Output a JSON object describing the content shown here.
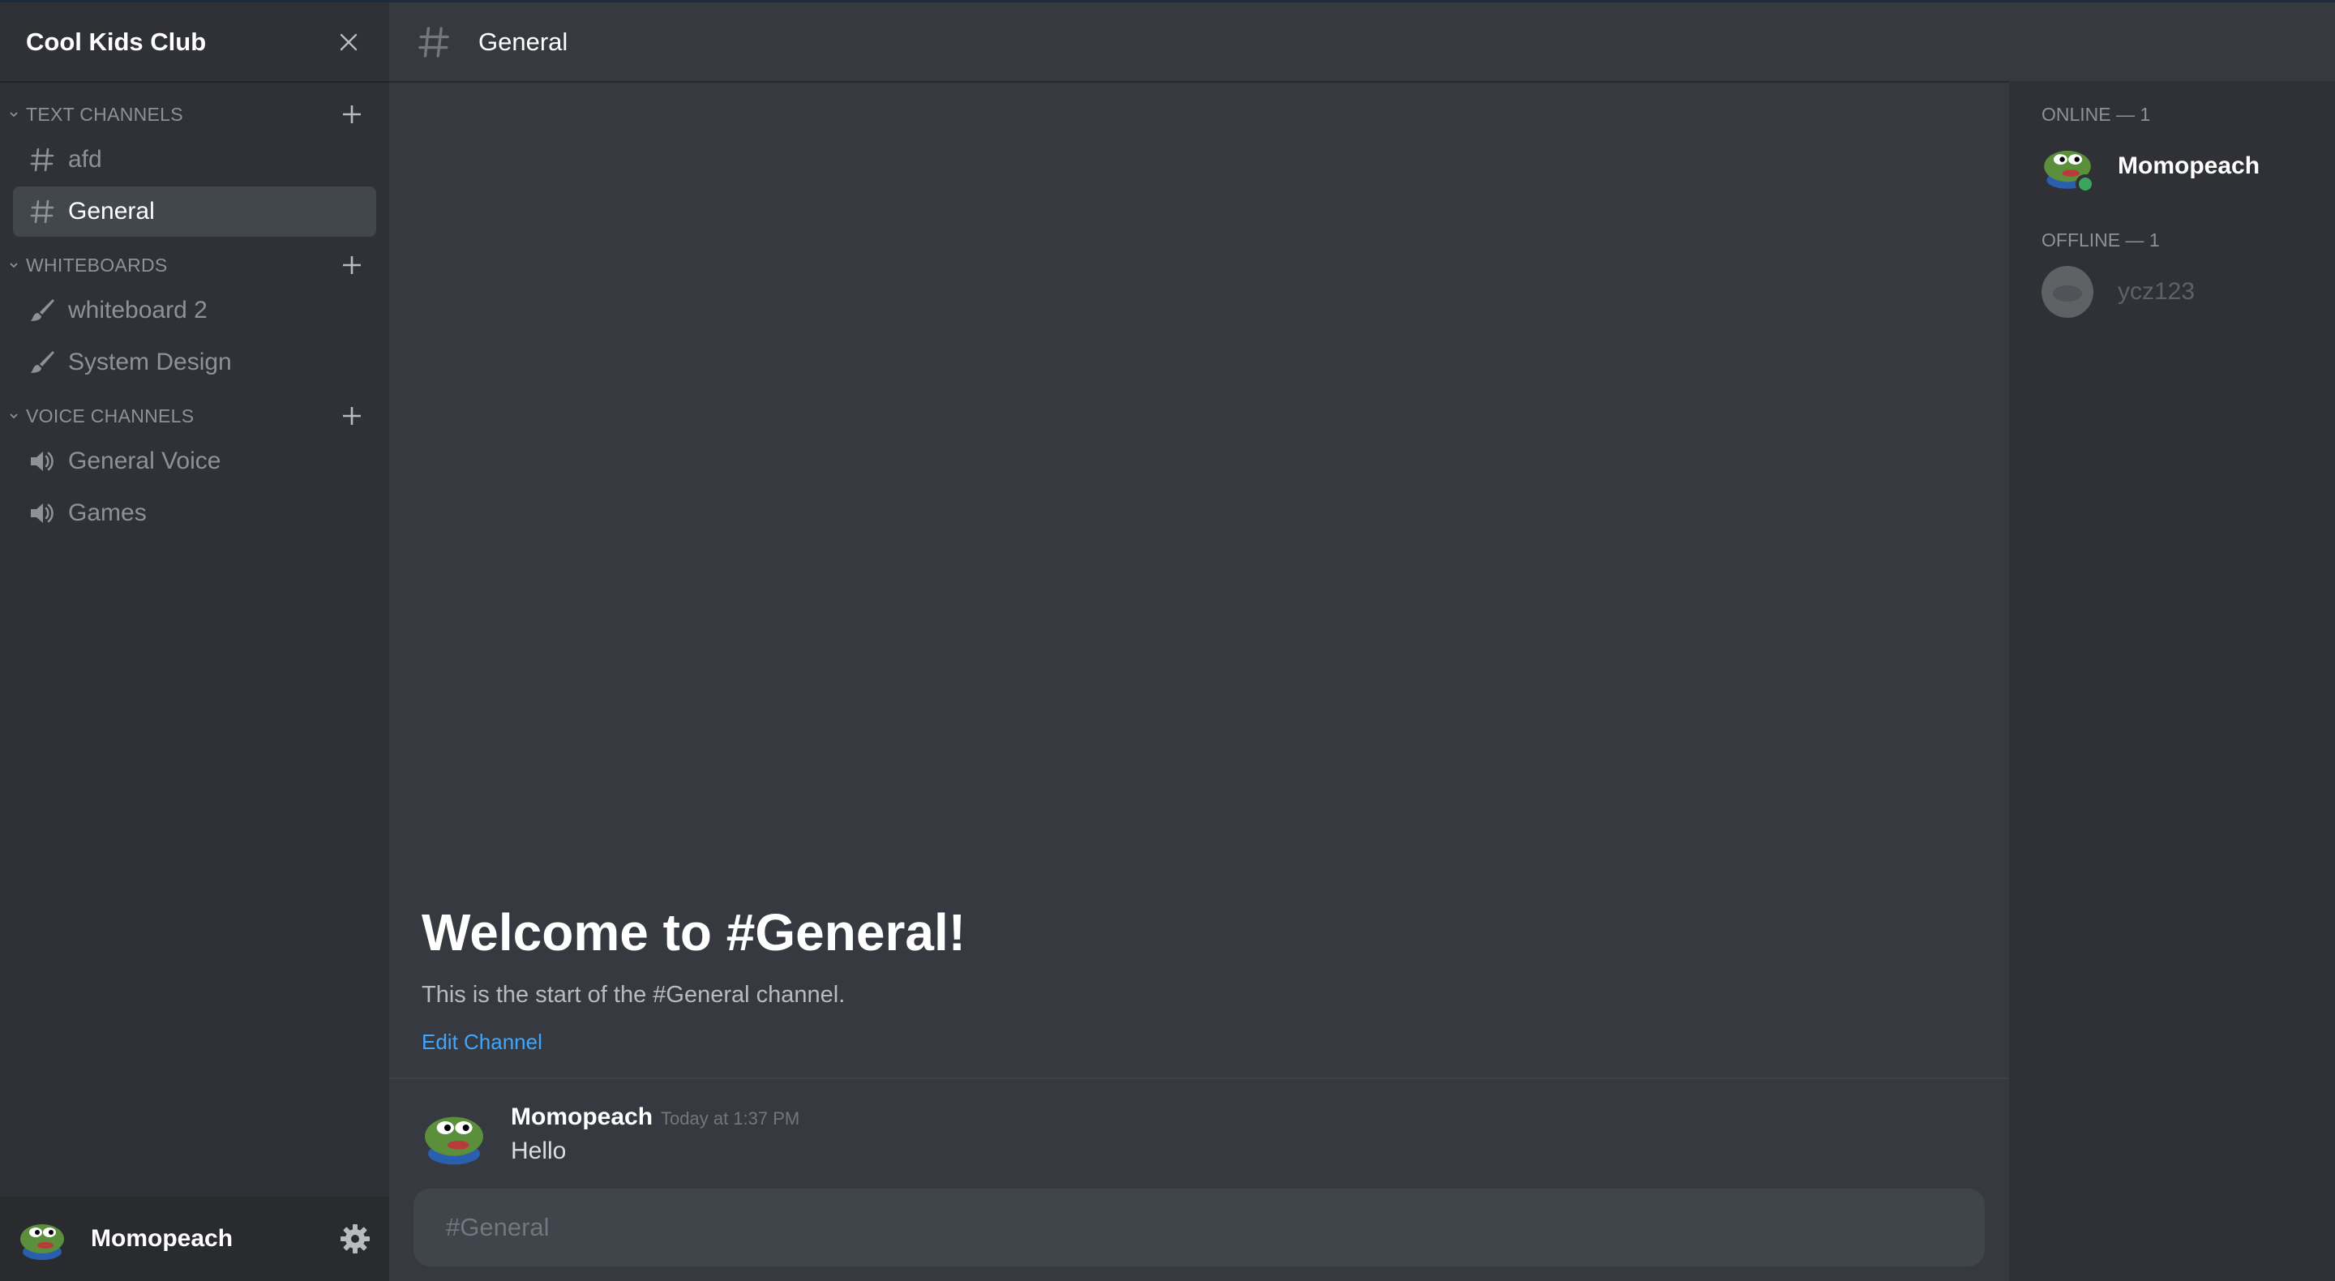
{
  "server": {
    "name": "Cool Kids Club"
  },
  "sidebar": {
    "categories": [
      {
        "label": "TEXT CHANNELS",
        "channels": [
          {
            "label": "afd",
            "icon": "hash-icon"
          },
          {
            "label": "General",
            "icon": "hash-icon",
            "active": true
          }
        ]
      },
      {
        "label": "WHITEBOARDS",
        "channels": [
          {
            "label": "whiteboard 2",
            "icon": "brush-icon"
          },
          {
            "label": "System Design",
            "icon": "brush-icon"
          }
        ]
      },
      {
        "label": "VOICE CHANNELS",
        "channels": [
          {
            "label": "General Voice",
            "icon": "speaker-icon"
          },
          {
            "label": "Games",
            "icon": "speaker-icon"
          }
        ]
      }
    ]
  },
  "user_panel": {
    "username": "Momopeach"
  },
  "header": {
    "channel_name": "General"
  },
  "welcome": {
    "title": "Welcome to #General!",
    "subtitle": "This is the start of the #General channel.",
    "edit_link": "Edit Channel"
  },
  "messages": [
    {
      "author": "Momopeach",
      "timestamp": "Today at 1:37 PM",
      "text": "Hello"
    }
  ],
  "composer": {
    "placeholder": "#General"
  },
  "members": {
    "online_label": "ONLINE — 1",
    "online": [
      {
        "name": "Momopeach"
      }
    ],
    "offline_label": "OFFLINE — 1",
    "offline": [
      {
        "name": "ycz123"
      }
    ]
  },
  "colors": {
    "sidebar_bg": "#2f3136",
    "main_bg": "#36393f",
    "link": "#3ea6ff",
    "online": "#3ba55d"
  }
}
